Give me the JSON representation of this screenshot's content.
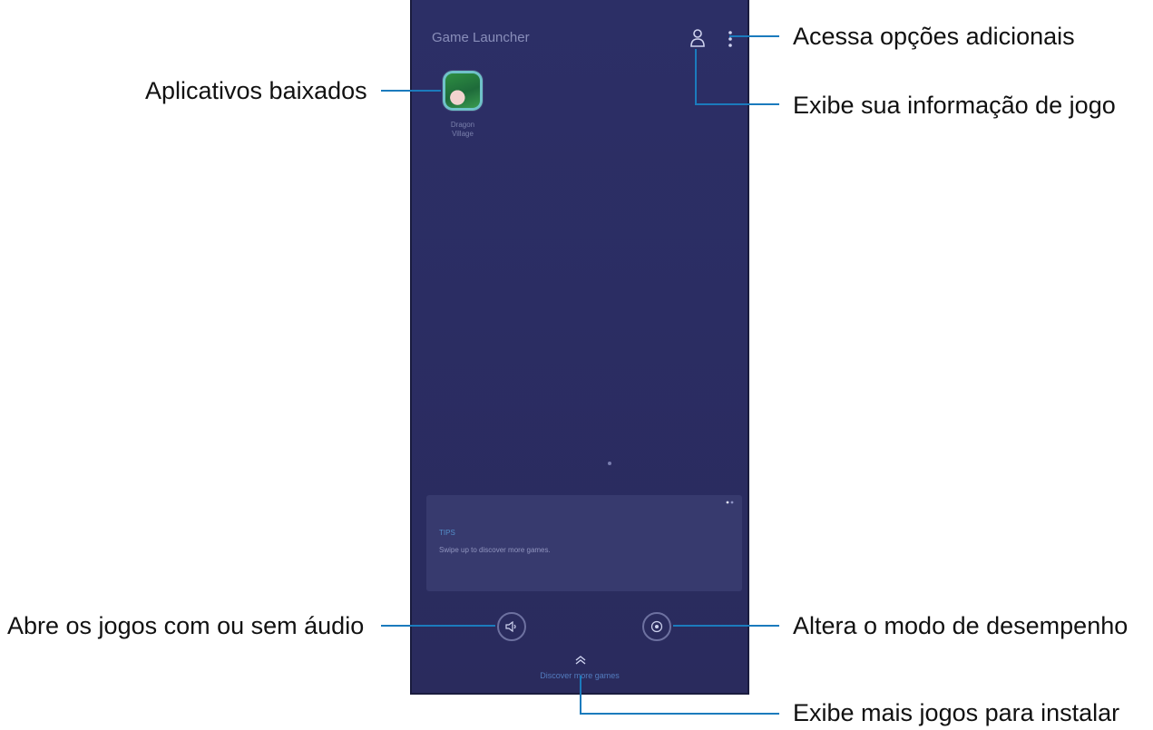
{
  "phone": {
    "app_title": "Game Launcher",
    "game": {
      "name": "Dragon\nVillage"
    },
    "tip": {
      "label": "TIPS",
      "text": "Swipe up to discover more games."
    },
    "more_games_label": "Discover more games"
  },
  "callouts": {
    "more_options": "Acessa opções adicionais",
    "game_info": "Exibe sua informação de jogo",
    "downloaded_apps": "Aplicativos baixados",
    "audio_mode": "Abre os jogos com ou sem áudio",
    "performance_mode": "Altera o modo de desempenho",
    "more_games": "Exibe mais jogos para instalar"
  },
  "colors": {
    "leader_line": "#1b7bbd",
    "screen_background": "#2b2d63",
    "accent_blue": "#5aa3e0"
  },
  "icons": [
    "profile-icon",
    "more-options-icon",
    "speaker-icon",
    "performance-icon",
    "chevron-up-icon",
    "close-icon"
  ]
}
